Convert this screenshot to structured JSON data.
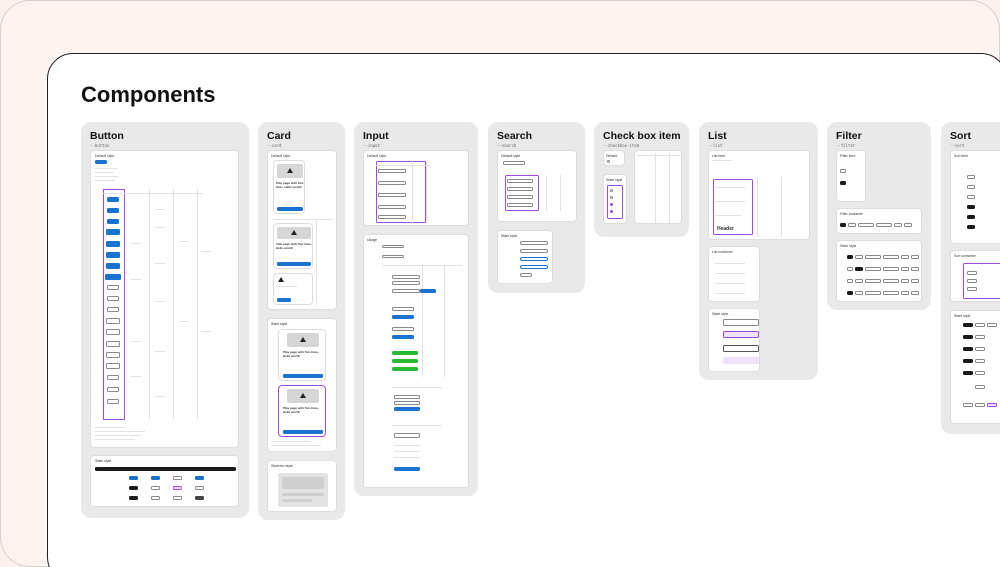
{
  "page": {
    "title": "Components"
  },
  "columns": [
    {
      "title": "Button",
      "token": "--button"
    },
    {
      "title": "Card",
      "token": "--card"
    },
    {
      "title": "Input",
      "token": "--input"
    },
    {
      "title": "Search",
      "token": "--search"
    },
    {
      "title": "Check box item",
      "token": "--checkbox-item"
    },
    {
      "title": "List",
      "token": "--list"
    },
    {
      "title": "Filter",
      "token": "--filter"
    },
    {
      "title": "Sort",
      "token": "--sort"
    }
  ],
  "frames": {
    "default_style": "Default style",
    "state_style": "State style",
    "usage": "Usage",
    "skeleton_style": "Skeleton style",
    "default": "Default",
    "list_item": "List item",
    "list_container": "List container",
    "filter_item": "Filter item",
    "filter_container": "Filter container",
    "sort_item": "Sort item",
    "sort_container": "Sort container"
  },
  "card_samples": {
    "heading_short": "Play page with Two lines, Hello world!",
    "heading_long": "Title page with Two lines, Hello world!"
  },
  "list_sample": {
    "header": "Header"
  },
  "colors": {
    "background": "#fdf1ee",
    "canvas": "#ffffff",
    "column_bg": "#e9e9e9",
    "primary": "#1a73d1",
    "selection": "#a24bd8",
    "success": "#2db834",
    "dark": "#1a1a1a"
  }
}
